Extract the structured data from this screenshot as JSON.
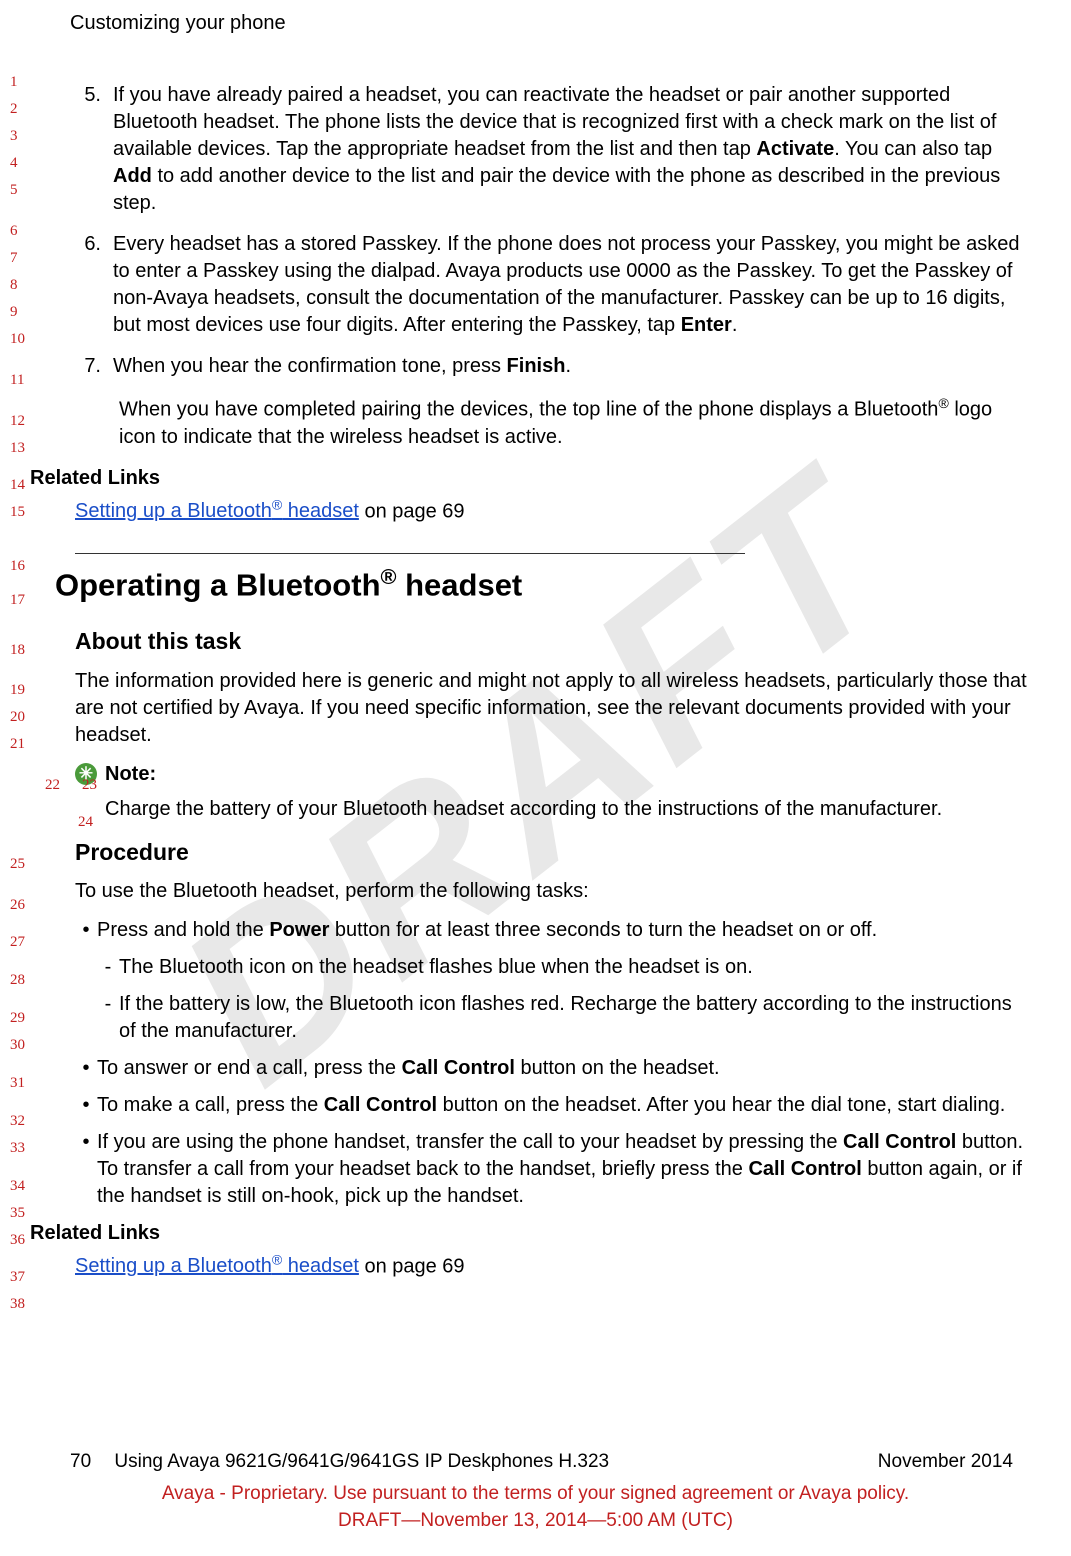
{
  "watermark": "DRAFT",
  "header": "Customizing your phone",
  "steps": {
    "s5_num": "5.",
    "s5_a": "If you have already paired a headset, you can reactivate the headset or pair another supported Bluetooth headset. The phone lists the device that is recognized first with a check mark on the list of available devices. Tap the appropriate headset from the list and then tap ",
    "s5_activate": "Activate",
    "s5_b": ". You can also tap ",
    "s5_add": "Add",
    "s5_c": " to add another device to the list and pair the device with the phone as described in the previous step.",
    "s6_num": "6.",
    "s6_a": "Every headset has a stored Passkey. If the phone does not process your Passkey, you might be asked to enter a Passkey using the dialpad. Avaya products use 0000 as the Passkey. To get the Passkey of non-Avaya headsets, consult the documentation of the manufacturer. Passkey can be up to 16 digits, but most devices use four digits. After entering the Passkey, tap ",
    "s6_enter": "Enter",
    "s6_b": ".",
    "s7_num": "7.",
    "s7_a": "When you hear the confirmation tone, press ",
    "s7_finish": "Finish",
    "s7_b": ".",
    "s7_after_a": "When you have completed pairing the devices, the top line of the phone displays a Bluetooth",
    "s7_after_b": " logo icon to indicate that the wireless headset is active."
  },
  "related1": {
    "heading": "Related Links",
    "link_a": "Setting up a Bluetooth",
    "link_b": " headset",
    "tail": " on page 69"
  },
  "section_title_a": "Operating a Bluetooth",
  "section_title_b": " headset",
  "about_heading": "About this task",
  "about_para": "The information provided here is generic and might not apply to all wireless headsets, particularly those that are not certified by Avaya. If you need specific information, see the relevant documents provided with your headset.",
  "note_label": "Note:",
  "note_body": "Charge the battery of your Bluetooth headset according to the instructions of the manufacturer.",
  "procedure_heading": "Procedure",
  "procedure_intro": "To use the Bluetooth headset, perform the following tasks:",
  "b1_a": "Press and hold the ",
  "b1_power": "Power",
  "b1_b": " button for at least three seconds to turn the headset on or off.",
  "d1": "The Bluetooth icon on the headset flashes blue when the headset is on.",
  "d2": "If the battery is low, the Bluetooth icon flashes red. Recharge the battery according to the instructions of the manufacturer.",
  "b2_a": "To answer or end a call, press the ",
  "b2_cc": "Call Control",
  "b2_b": " button on the headset.",
  "b3_a": "To make a call, press the ",
  "b3_b": " button on the headset. After you hear the dial tone, start dialing.",
  "b4_a": "If you are using the phone handset, transfer the call to your headset by pressing the ",
  "b4_b": " button. To transfer a call from your headset back to the handset, briefly press the ",
  "b4_c": " button again, or if the handset is still on-hook, pick up the handset.",
  "related2": {
    "heading": "Related Links",
    "link_a": "Setting up a Bluetooth",
    "link_b": " headset",
    "tail": " on page 69"
  },
  "footer": {
    "page_num": "70",
    "doc_title": "Using Avaya 9621G/9641G/9641GS IP Deskphones H.323",
    "date": "November 2014",
    "line2": "Avaya - Proprietary. Use pursuant to the terms of your signed agreement or Avaya policy.",
    "line3": "DRAFT—November 13, 2014—5:00 AM (UTC)"
  },
  "line_numbers": {
    "l1": "1",
    "l2": "2",
    "l3": "3",
    "l4": "4",
    "l5": "5",
    "l6": "6",
    "l7": "7",
    "l8": "8",
    "l9": "9",
    "l10": "10",
    "l11": "11",
    "l12": "12",
    "l13": "13",
    "l14": "14",
    "l15": "15",
    "l16": "16",
    "l17": "17",
    "l18": "18",
    "l19": "19",
    "l20": "20",
    "l21": "21",
    "l22": "22",
    "l23": "23",
    "l24": "24",
    "l25": "25",
    "l26": "26",
    "l27": "27",
    "l28": "28",
    "l29": "29",
    "l30": "30",
    "l31": "31",
    "l32": "32",
    "l33": "33",
    "l34": "34",
    "l35": "35",
    "l36": "36",
    "l37": "37",
    "l38": "38"
  }
}
